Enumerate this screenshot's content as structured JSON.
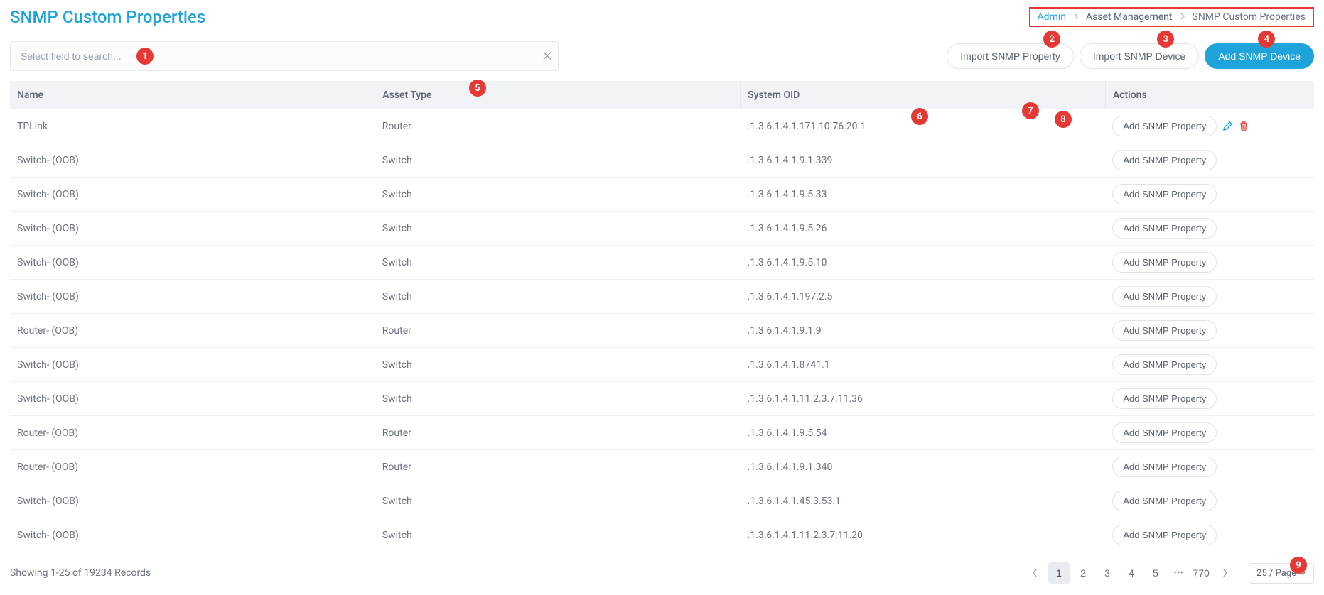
{
  "page_title": "SNMP Custom Properties",
  "breadcrumb": {
    "admin": "Admin",
    "asset": "Asset Management",
    "current": "SNMP Custom Properties"
  },
  "search": {
    "placeholder": "Select field to search..."
  },
  "buttons": {
    "import_property": "Import SNMP Property",
    "import_device": "Import SNMP Device",
    "add_device": "Add SNMP Device",
    "add_property": "Add SNMP Property"
  },
  "columns": {
    "name": "Name",
    "asset_type": "Asset Type",
    "system_oid": "System OID",
    "actions": "Actions"
  },
  "rows": [
    {
      "name": "TPLink",
      "asset_type": "Router",
      "oid": ".1.3.6.1.4.1.171.10.76.20.1",
      "show_icons": true
    },
    {
      "name": "Switch- (OOB)",
      "asset_type": "Switch",
      "oid": ".1.3.6.1.4.1.9.1.339"
    },
    {
      "name": "Switch- (OOB)",
      "asset_type": "Switch",
      "oid": ".1.3.6.1.4.1.9.5.33"
    },
    {
      "name": "Switch- (OOB)",
      "asset_type": "Switch",
      "oid": ".1.3.6.1.4.1.9.5.26"
    },
    {
      "name": "Switch- (OOB)",
      "asset_type": "Switch",
      "oid": ".1.3.6.1.4.1.9.5.10"
    },
    {
      "name": "Switch- (OOB)",
      "asset_type": "Switch",
      "oid": ".1.3.6.1.4.1.197.2.5"
    },
    {
      "name": "Router- (OOB)",
      "asset_type": "Router",
      "oid": ".1.3.6.1.4.1.9.1.9"
    },
    {
      "name": "Switch- (OOB)",
      "asset_type": "Switch",
      "oid": ".1.3.6.1.4.1.8741.1"
    },
    {
      "name": "Switch- (OOB)",
      "asset_type": "Switch",
      "oid": ".1.3.6.1.4.1.11.2.3.7.11.36"
    },
    {
      "name": "Router- (OOB)",
      "asset_type": "Router",
      "oid": ".1.3.6.1.4.1.9.5.54"
    },
    {
      "name": "Router- (OOB)",
      "asset_type": "Router",
      "oid": ".1.3.6.1.4.1.9.1.340"
    },
    {
      "name": "Switch- (OOB)",
      "asset_type": "Switch",
      "oid": ".1.3.6.1.4.1.45.3.53.1"
    },
    {
      "name": "Switch- (OOB)",
      "asset_type": "Switch",
      "oid": ".1.3.6.1.4.1.11.2.3.7.11.20"
    }
  ],
  "records_info": "Showing 1-25 of 19234 Records",
  "pagination": {
    "pages": [
      "1",
      "2",
      "3",
      "4",
      "5"
    ],
    "last": "770"
  },
  "page_size": "25 / Page",
  "markers": {
    "m1": "1",
    "m2": "2",
    "m3": "3",
    "m4": "4",
    "m5": "5",
    "m6": "6",
    "m7": "7",
    "m8": "8",
    "m9": "9"
  }
}
